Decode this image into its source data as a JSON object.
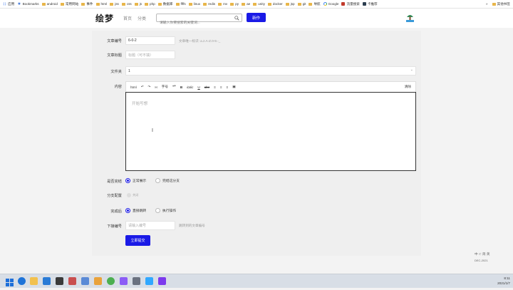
{
  "bookmarks": [
    {
      "label": "应用",
      "icon": "apps-icon"
    },
    {
      "label": "Bookmarks",
      "icon": "star-icon"
    },
    {
      "label": "android",
      "icon": "folder-icon"
    },
    {
      "label": "常用网站",
      "icon": "folder-icon"
    },
    {
      "label": "事件",
      "icon": "folder-icon"
    },
    {
      "label": "html",
      "icon": "folder-icon"
    },
    {
      "label": "jss",
      "icon": "folder-icon"
    },
    {
      "label": "css",
      "icon": "folder-icon"
    },
    {
      "label": "js",
      "icon": "folder-icon"
    },
    {
      "label": "php",
      "icon": "folder-icon"
    },
    {
      "label": "数据库",
      "icon": "folder-icon"
    },
    {
      "label": "ffffs",
      "icon": "folder-icon"
    },
    {
      "label": "linux",
      "icon": "folder-icon"
    },
    {
      "label": "redis",
      "icon": "folder-icon"
    },
    {
      "label": "mv",
      "icon": "folder-icon"
    },
    {
      "label": "py",
      "icon": "folder-icon"
    },
    {
      "label": "ae",
      "icon": "folder-icon"
    },
    {
      "label": "unity",
      "icon": "folder-icon"
    },
    {
      "label": "docker",
      "icon": "folder-icon"
    },
    {
      "label": "jsp",
      "icon": "folder-icon"
    },
    {
      "label": "git",
      "icon": "folder-icon"
    },
    {
      "label": "导航",
      "icon": "folder-icon"
    },
    {
      "label": "Google",
      "icon": "google-icon"
    },
    {
      "label": "流量搜索",
      "icon": "site-icon"
    },
    {
      "label": "卡推荐",
      "icon": "site-icon"
    }
  ],
  "bookmarks_right": {
    "more": "»",
    "other": "其他书签"
  },
  "header": {
    "logo": "绘梦",
    "nav": [
      "首页",
      "分类"
    ],
    "search_placeholder": "请输入你要搜索的关键词...",
    "new_button": "新作"
  },
  "form": {
    "chapter_no": {
      "label": "文章编号",
      "value": "6-0-2",
      "hint": "文章唯一标识: a.z.A-Z.0-9.-_"
    },
    "title": {
      "label": "文章标题",
      "placeholder": "标题（可不填）"
    },
    "category": {
      "label": "文件夹",
      "value": "1"
    },
    "content": {
      "label": "内容",
      "toolbar": [
        "html",
        "↶",
        "↷",
        "H",
        "字号",
        "❝❞",
        "B",
        "italic",
        "U",
        "abc",
        "≡",
        "≡",
        "≡",
        "▣"
      ],
      "toolbar_right": "清除",
      "placeholder": "开始写想"
    },
    "completion": {
      "label": "是否完结",
      "options": [
        "正常展示",
        "完结这分支"
      ],
      "selected": 0
    },
    "branch_conf": {
      "label": "分支配置",
      "value": "关闭"
    },
    "after_done": {
      "label": "完成后",
      "options": [
        "直接跳转",
        "执行操作"
      ],
      "selected": 0
    },
    "next_no": {
      "label": "下接编号",
      "placeholder": "请输入编号",
      "hint": "跳转到的文章编号"
    },
    "submit": "立即提交"
  },
  "ime": {
    "line1": "中 ⊂ 简 英",
    "line2": "DEC-2021"
  },
  "tray": {
    "time": "8:11",
    "date": "2021/1/7"
  }
}
